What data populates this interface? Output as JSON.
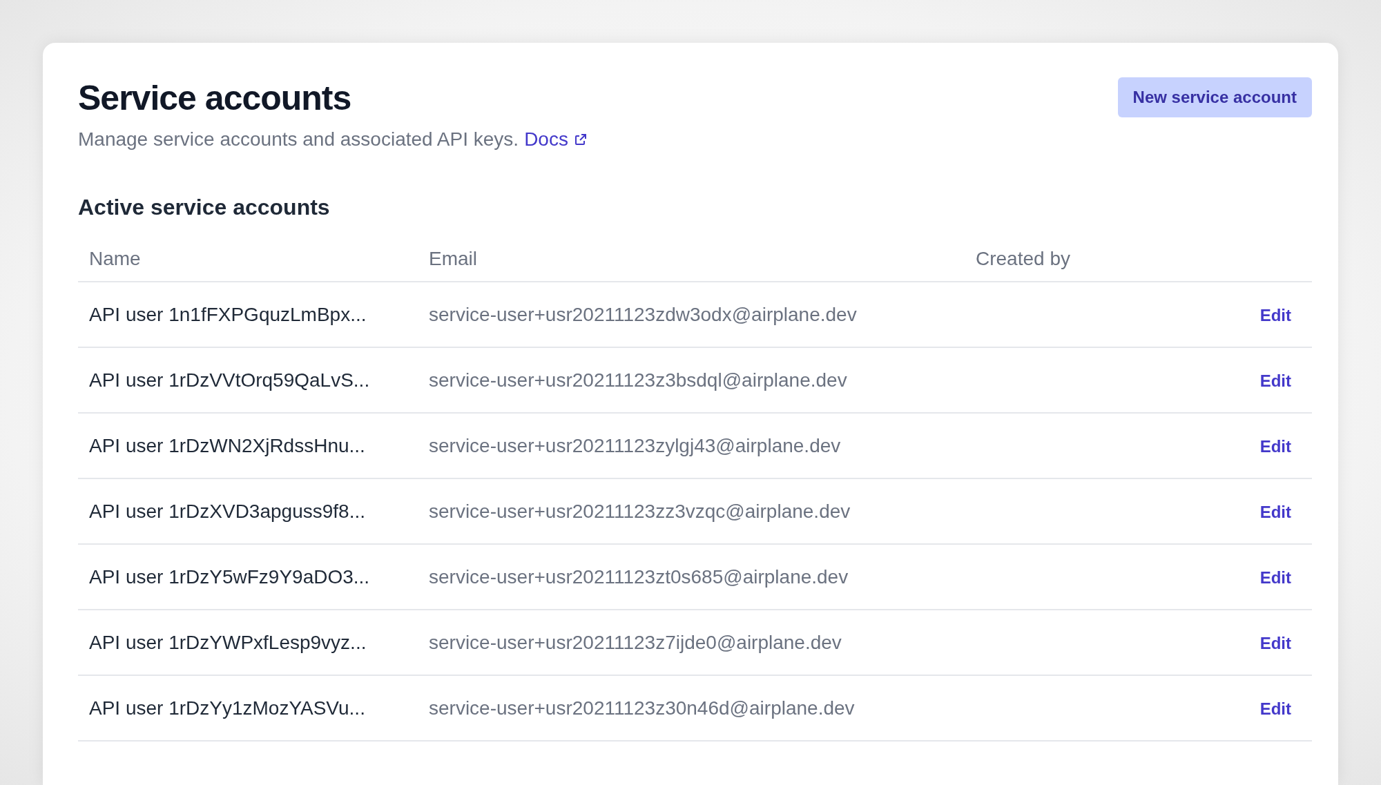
{
  "page": {
    "title": "Service accounts",
    "description": "Manage service accounts and associated API keys.",
    "docs_link": "Docs",
    "new_button": "New service account"
  },
  "section": {
    "title": "Active service accounts"
  },
  "table": {
    "columns": [
      "Name",
      "Email",
      "Created by"
    ],
    "rows": [
      {
        "name": "API user 1n1fFXPGquzLmBpx...",
        "email": "service-user+usr20211123zdw3odx@airplane.dev",
        "action": "Edit"
      },
      {
        "name": "API user 1rDzVVtOrq59QaLvS...",
        "email": "service-user+usr20211123z3bsdql@airplane.dev",
        "action": "Edit"
      },
      {
        "name": "API user 1rDzWN2XjRdssHnu...",
        "email": "service-user+usr20211123zylgj43@airplane.dev",
        "action": "Edit"
      },
      {
        "name": "API user 1rDzXVD3apguss9f8...",
        "email": "service-user+usr20211123zz3vzqc@airplane.dev",
        "action": "Edit"
      },
      {
        "name": "API user 1rDzY5wFz9Y9aDO3...",
        "email": "service-user+usr20211123zt0s685@airplane.dev",
        "action": "Edit"
      },
      {
        "name": "API user 1rDzYWPxfLesp9vyz...",
        "email": "service-user+usr20211123z7ijde0@airplane.dev",
        "action": "Edit"
      },
      {
        "name": "API user 1rDzYy1zMozYASVu...",
        "email": "service-user+usr20211123z30n46d@airplane.dev",
        "action": "Edit"
      }
    ]
  }
}
